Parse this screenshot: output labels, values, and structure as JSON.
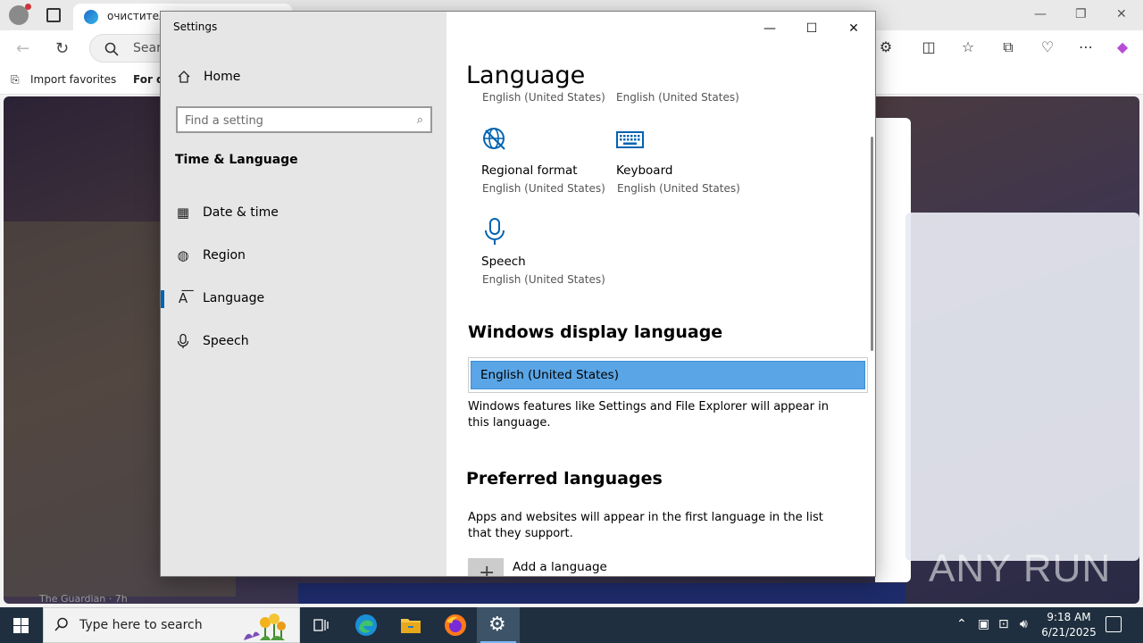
{
  "browser": {
    "tab_title": "очиститель",
    "address_placeholder": "Search",
    "favorites": [
      "Import favorites",
      "For qu"
    ],
    "news_source": "The Guardian · 7h"
  },
  "settings": {
    "window_title": "Settings",
    "home_label": "Home",
    "search_placeholder": "Find a setting",
    "category": "Time & Language",
    "nav": [
      {
        "label": "Date & time",
        "icon": "calendar-clock-icon"
      },
      {
        "label": "Region",
        "icon": "globe-icon"
      },
      {
        "label": "Language",
        "icon": "language-icon",
        "active": true
      },
      {
        "label": "Speech",
        "icon": "microphone-icon"
      }
    ],
    "page_title": "Language",
    "cut_off_subtitles": [
      "English (United States)",
      "English (United States)"
    ],
    "tiles": [
      {
        "label": "Regional format",
        "sub": "English (United States)",
        "icon": "regional-format-icon"
      },
      {
        "label": "Keyboard",
        "sub": "English (United States)",
        "icon": "keyboard-icon"
      },
      {
        "label": "Speech",
        "sub": "English (United States)",
        "icon": "microphone-icon"
      }
    ],
    "display_language": {
      "heading": "Windows display language",
      "selected": "English (United States)",
      "description": "Windows features like Settings and File Explorer will appear in this language."
    },
    "preferred": {
      "heading": "Preferred languages",
      "description": "Apps and websites will appear in the first language in the list that they support.",
      "add_label": "Add a language"
    }
  },
  "taskbar": {
    "search_placeholder": "Type here to search",
    "time": "9:18 AM",
    "date": "6/21/2025"
  },
  "watermark": "ANY RUN",
  "colors": {
    "accent": "#0063b1",
    "selected_language_bg": "#5aa5e6",
    "taskbar_bg": "#1f2f3f",
    "icon_blue": "#0063b1"
  }
}
